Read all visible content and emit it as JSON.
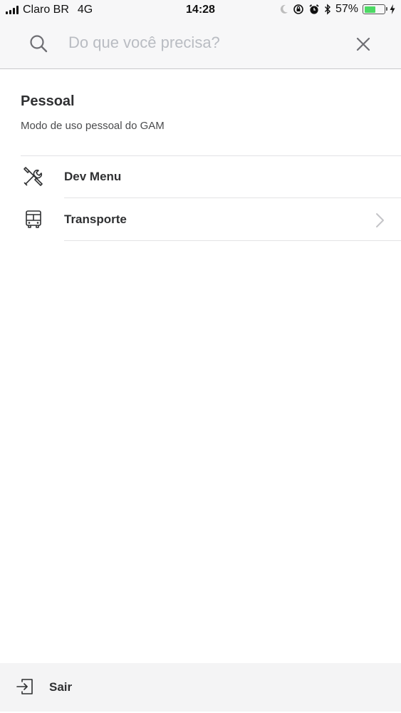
{
  "status_bar": {
    "carrier": "Claro BR",
    "network": "4G",
    "time": "14:28",
    "battery_percent": "57%",
    "battery_level": 0.57,
    "battery_color": "#4cd964",
    "icons": [
      "signal-icon",
      "moon-icon",
      "rotation-lock-icon",
      "alarm-icon",
      "bluetooth-icon",
      "battery-icon",
      "charging-icon"
    ]
  },
  "search": {
    "placeholder": "Do que você precisa?",
    "value": "",
    "icon": "search-icon",
    "close_icon": "close-icon"
  },
  "section": {
    "title": "Pessoal",
    "subtitle": "Modo de uso pessoal do GAM"
  },
  "menu": {
    "items": [
      {
        "label": "Dev Menu",
        "icon": "tools-icon"
      },
      {
        "label": "Transporte",
        "icon": "bus-icon",
        "chevron": "chevron-right-icon"
      }
    ]
  },
  "footer": {
    "logout_label": "Sair",
    "icon": "logout-icon"
  }
}
